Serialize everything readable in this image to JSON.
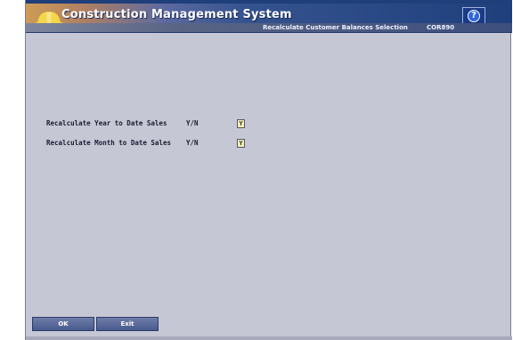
{
  "app": {
    "title": "Construction Management System",
    "help_glyph": "?",
    "screen_title": "Recalculate Customer Balances Selection",
    "screen_code": "COR890"
  },
  "form": {
    "fields": [
      {
        "label": "Recalculate Year to Date Sales",
        "yn": "Y/N",
        "value": "Y"
      },
      {
        "label": "Recalculate Month to Date Sales",
        "yn": "Y/N",
        "value": "Y"
      }
    ]
  },
  "buttons": {
    "ok": "OK",
    "exit": "Exit"
  },
  "colors": {
    "background": "#c6c7d4",
    "banner": "#1f3f7c",
    "input_fill": "#f2f0b4"
  },
  "icons": {
    "logo": "hardhat-icon",
    "help": "help-icon"
  }
}
